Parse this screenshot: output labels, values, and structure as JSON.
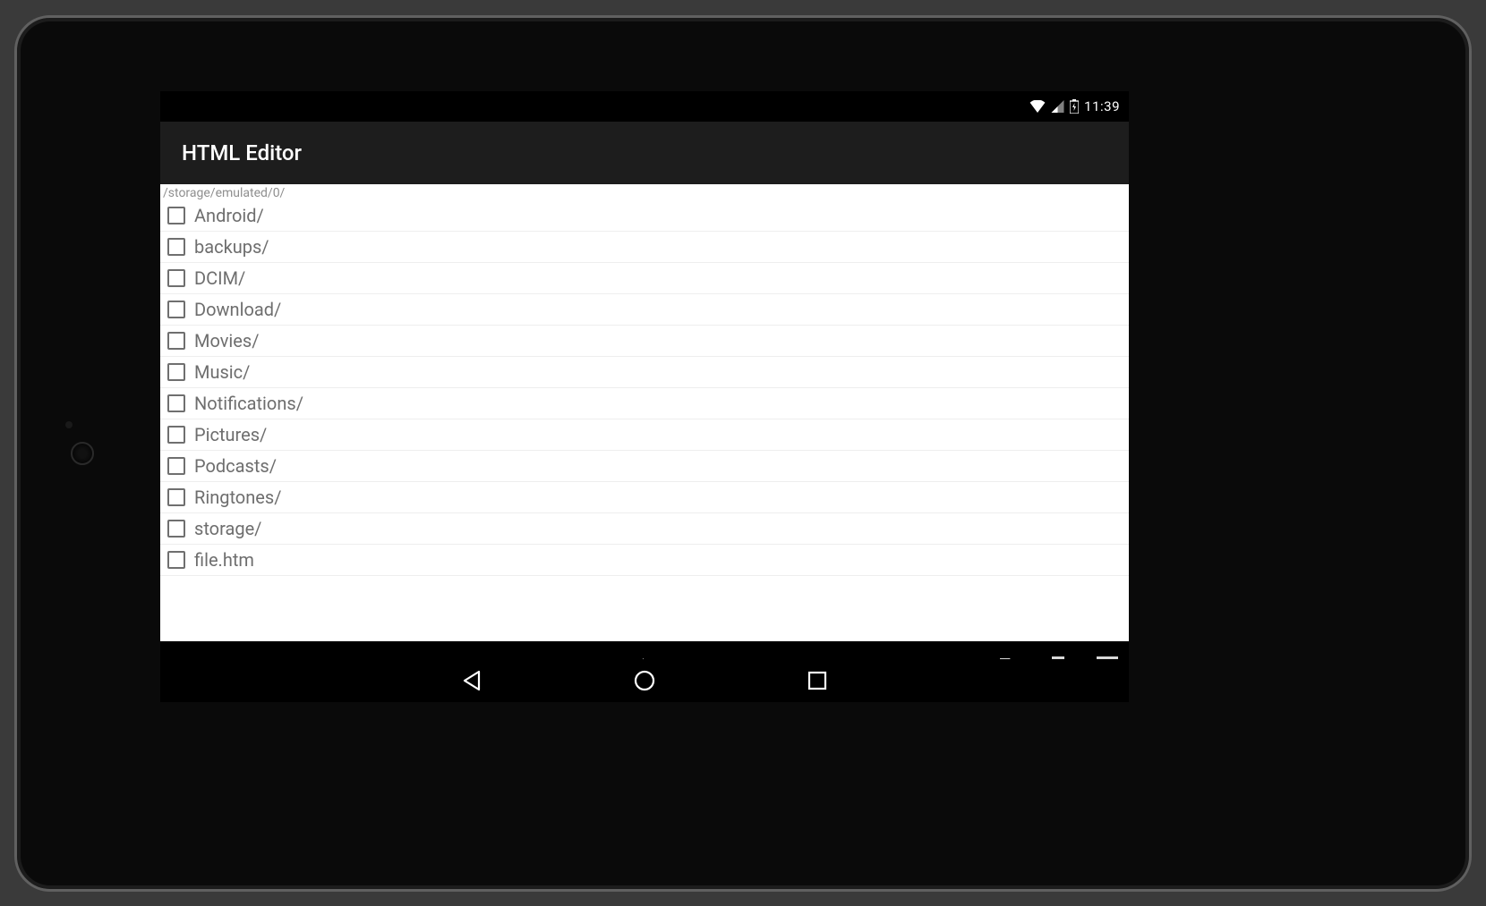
{
  "status_bar": {
    "time": "11:39"
  },
  "app_bar": {
    "title": "HTML Editor"
  },
  "path": "/storage/emulated/0/",
  "files": [
    {
      "name": "Android/"
    },
    {
      "name": "backups/"
    },
    {
      "name": "DCIM/"
    },
    {
      "name": "Download/"
    },
    {
      "name": "Movies/"
    },
    {
      "name": "Music/"
    },
    {
      "name": "Notifications/"
    },
    {
      "name": "Pictures/"
    },
    {
      "name": "Podcasts/"
    },
    {
      "name": "Ringtones/"
    },
    {
      "name": "storage/"
    },
    {
      "name": "file.htm"
    }
  ]
}
